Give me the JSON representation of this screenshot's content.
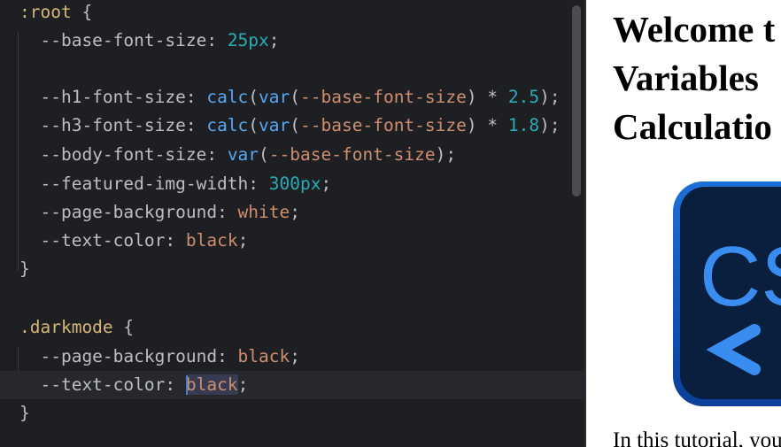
{
  "editor": {
    "lines": [
      {
        "segs": [
          [
            ":root",
            "sel"
          ],
          [
            " {",
            "brace"
          ]
        ]
      },
      {
        "segs": [
          [
            "  --base-font-size",
            "prop"
          ],
          [
            ": ",
            "prop"
          ],
          [
            "25px",
            "num"
          ],
          [
            ";",
            "prop"
          ]
        ]
      },
      {
        "segs": []
      },
      {
        "segs": [
          [
            "  --h1-font-size",
            "prop"
          ],
          [
            ": ",
            "prop"
          ],
          [
            "calc",
            "fn"
          ],
          [
            "(",
            "prop"
          ],
          [
            "var",
            "fn"
          ],
          [
            "(",
            "prop"
          ],
          [
            "--base-font-size",
            "kw"
          ],
          [
            ") * ",
            "prop"
          ],
          [
            "2.5",
            "num"
          ],
          [
            ");",
            "prop"
          ]
        ]
      },
      {
        "segs": [
          [
            "  --h3-font-size",
            "prop"
          ],
          [
            ": ",
            "prop"
          ],
          [
            "calc",
            "fn"
          ],
          [
            "(",
            "prop"
          ],
          [
            "var",
            "fn"
          ],
          [
            "(",
            "prop"
          ],
          [
            "--base-font-size",
            "kw"
          ],
          [
            ") * ",
            "prop"
          ],
          [
            "1.8",
            "num"
          ],
          [
            ");",
            "prop"
          ]
        ]
      },
      {
        "segs": [
          [
            "  --body-font-size",
            "prop"
          ],
          [
            ": ",
            "prop"
          ],
          [
            "var",
            "fn"
          ],
          [
            "(",
            "prop"
          ],
          [
            "--base-font-size",
            "kw"
          ],
          [
            ");",
            "prop"
          ]
        ]
      },
      {
        "segs": [
          [
            "  --featured-img-width",
            "prop"
          ],
          [
            ": ",
            "prop"
          ],
          [
            "300px",
            "num"
          ],
          [
            ";",
            "prop"
          ]
        ]
      },
      {
        "segs": [
          [
            "  --page-background",
            "prop"
          ],
          [
            ": ",
            "prop"
          ],
          [
            "white",
            "kw"
          ],
          [
            ";",
            "prop"
          ]
        ]
      },
      {
        "segs": [
          [
            "  --text-color",
            "prop"
          ],
          [
            ": ",
            "prop"
          ],
          [
            "black",
            "kw"
          ],
          [
            ";",
            "prop"
          ]
        ]
      },
      {
        "segs": [
          [
            "}",
            "brace"
          ]
        ]
      },
      {
        "segs": []
      },
      {
        "segs": [
          [
            ".darkmode",
            "sel"
          ],
          [
            " {",
            "brace"
          ]
        ]
      },
      {
        "segs": [
          [
            "  --page-background",
            "prop"
          ],
          [
            ": ",
            "prop"
          ],
          [
            "black",
            "kw"
          ],
          [
            ";",
            "prop"
          ]
        ]
      },
      {
        "segs": [
          [
            "  --text-color",
            "prop"
          ],
          [
            ": ",
            "prop"
          ],
          [
            "black",
            "kw-caret"
          ],
          [
            ";",
            "prop"
          ]
        ],
        "current": true
      },
      {
        "segs": [
          [
            "}",
            "brace"
          ]
        ]
      }
    ]
  },
  "preview": {
    "heading": "Welcome t\nVariables \nCalculatio",
    "logo_text": "CS",
    "body_text": "In this tutorial, you'",
    "logo_icon": "css-logo-icon"
  },
  "colors": {
    "editor_bg": "#1e1f22",
    "accent_blue": "#56a8f5",
    "keyword_orange": "#cf8e6d",
    "number_teal": "#2aacb8"
  }
}
